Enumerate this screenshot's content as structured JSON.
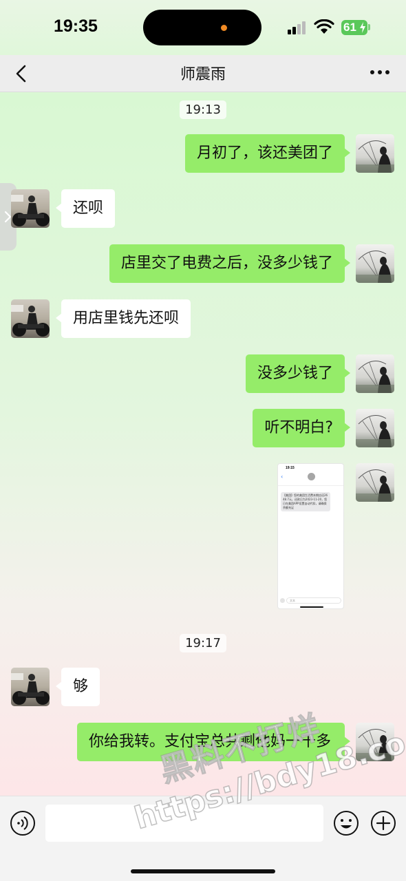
{
  "status_bar": {
    "time": "19:35",
    "battery": "61"
  },
  "nav": {
    "title": "师震雨"
  },
  "timestamps": [
    "19:13",
    "19:17"
  ],
  "messages": [
    {
      "side": "me",
      "text": "月初了，该还美团了"
    },
    {
      "side": "them",
      "text": "还呗"
    },
    {
      "side": "me",
      "text": "店里交了电费之后，没多少钱了"
    },
    {
      "side": "them",
      "text": "用店里钱先还呗"
    },
    {
      "side": "me",
      "text": "没多少钱了"
    },
    {
      "side": "me",
      "text": "听不明白?"
    },
    {
      "side": "me",
      "type": "image"
    },
    {
      "side": "them",
      "text": "够"
    },
    {
      "side": "me",
      "text": "你给我转。支付宝总共剩他妈一千多"
    }
  ],
  "screenshot_thumb": {
    "time": "19:15",
    "message": "【美团】您的美团生活费本期应还2648.7元，还款日为2023-11-20，您已在美团APP设置自动代扣，请确保余额充足",
    "input_placeholder": "文本"
  },
  "input": {
    "value": ""
  },
  "watermark": {
    "line1": "黑料不打烊",
    "line2": "https://bdy18.co"
  },
  "icons": {
    "back": "chevron-left-icon",
    "more": "more-dots-icon",
    "voice": "voice-icon",
    "emoji": "emoji-icon",
    "plus": "plus-icon"
  },
  "colors": {
    "my_bubble": "#95ec69",
    "their_bubble": "#ffffff",
    "battery": "#5ac85a"
  }
}
